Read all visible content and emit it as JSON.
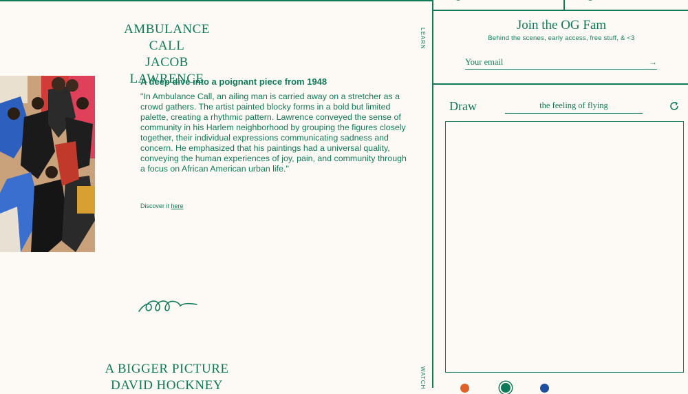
{
  "art": {
    "title_line1": "AMBULANCE CALL",
    "title_line2": "JACOB LAWRENCE",
    "subtitle": "A deep dive into a poignant piece from 1948",
    "description": "\"In Ambulance Call, an ailing man is carried away on a stretcher as a crowd gathers. The artist painted blocky forms in a bold but limited palette, creating a rhythmic pattern. Lawrence conveyed the sense of community in his Harlem neighborhood by grouping the figures closely together, their individual expressions communicating sadness and concern. He emphasized that his paintings had a universal quality, conveying the human experiences of joy, pain, and community through a focus on African American urban life.\"",
    "discover_prefix": "Discover it",
    "discover_link": "here"
  },
  "next_art": {
    "title_line1": "A BIGGER PICTURE",
    "title_line2": "DAVID HOCKNEY"
  },
  "side_labels": {
    "learn": "LEARN",
    "watch": "WATCH"
  },
  "newsletter": {
    "title": "Join the OG Fam",
    "subtitle": "Behind the scenes, early access, free stuff, & <3",
    "email_placeholder": "Your email",
    "submit_icon": "arrow-right-icon"
  },
  "draw": {
    "label": "Draw",
    "prompt": "the feeling of flying",
    "refresh_icon": "refresh-icon",
    "colors": [
      "#e0602a",
      "#0f7a5a",
      "#1f4fa0"
    ]
  },
  "theme": {
    "accent": "#0f7a5a",
    "background": "#fdfaf5"
  }
}
